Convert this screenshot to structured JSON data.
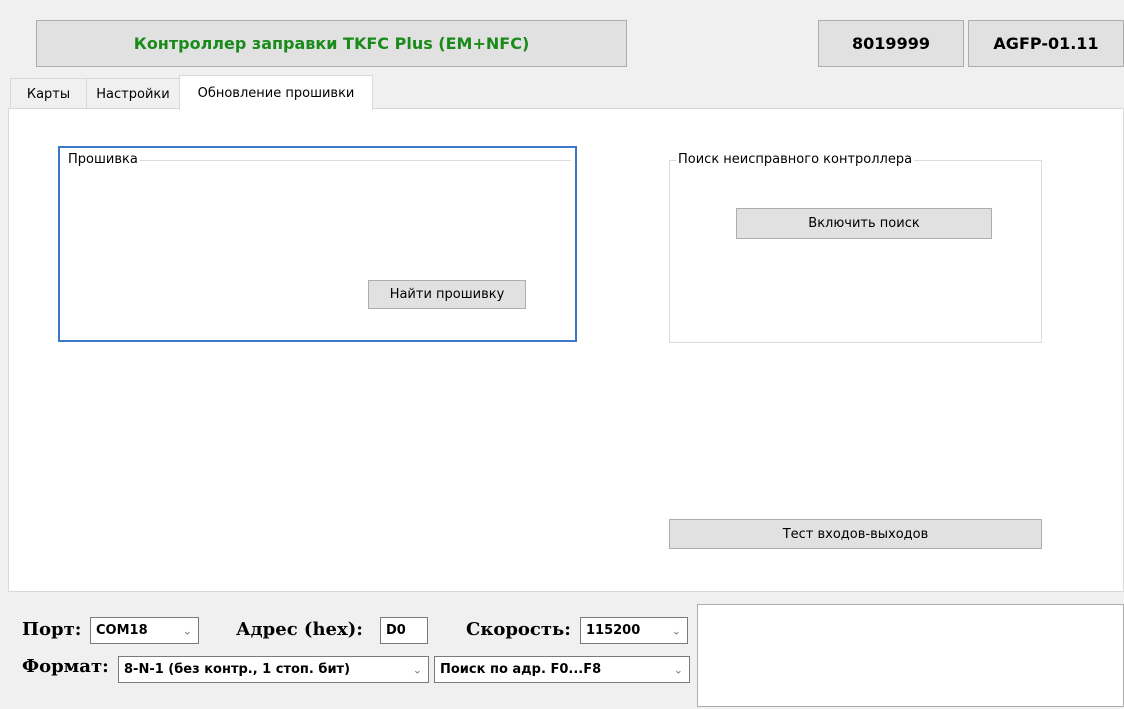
{
  "header": {
    "title_button": "Контроллер заправки TKFC Plus (EM+NFC)",
    "serial_button": "8019999",
    "version_button": "AGFP-01.11"
  },
  "tabs": [
    "Карты",
    "Настройки",
    "Обновление прошивки"
  ],
  "firmware_group": {
    "legend": "Прошивка",
    "find_button": "Найти прошивку"
  },
  "search_group": {
    "legend": "Поиск неисправного контроллера",
    "enable_button": "Включить поиск"
  },
  "io_test_button": "Тест входов-выходов",
  "footer": {
    "port_label": "Порт:",
    "port_value": "COM18",
    "address_label": "Адрес (hex):",
    "address_value": "D0",
    "speed_label": "Скорость:",
    "speed_value": "115200",
    "format_label": "Формат:",
    "format_value": "8-N-1 (без контр., 1 стоп. бит)",
    "search_mode_value": "Поиск по адр. F0...F8"
  },
  "colors": {
    "title_text": "#1a8a1a",
    "focus_border": "#3c78c8"
  }
}
